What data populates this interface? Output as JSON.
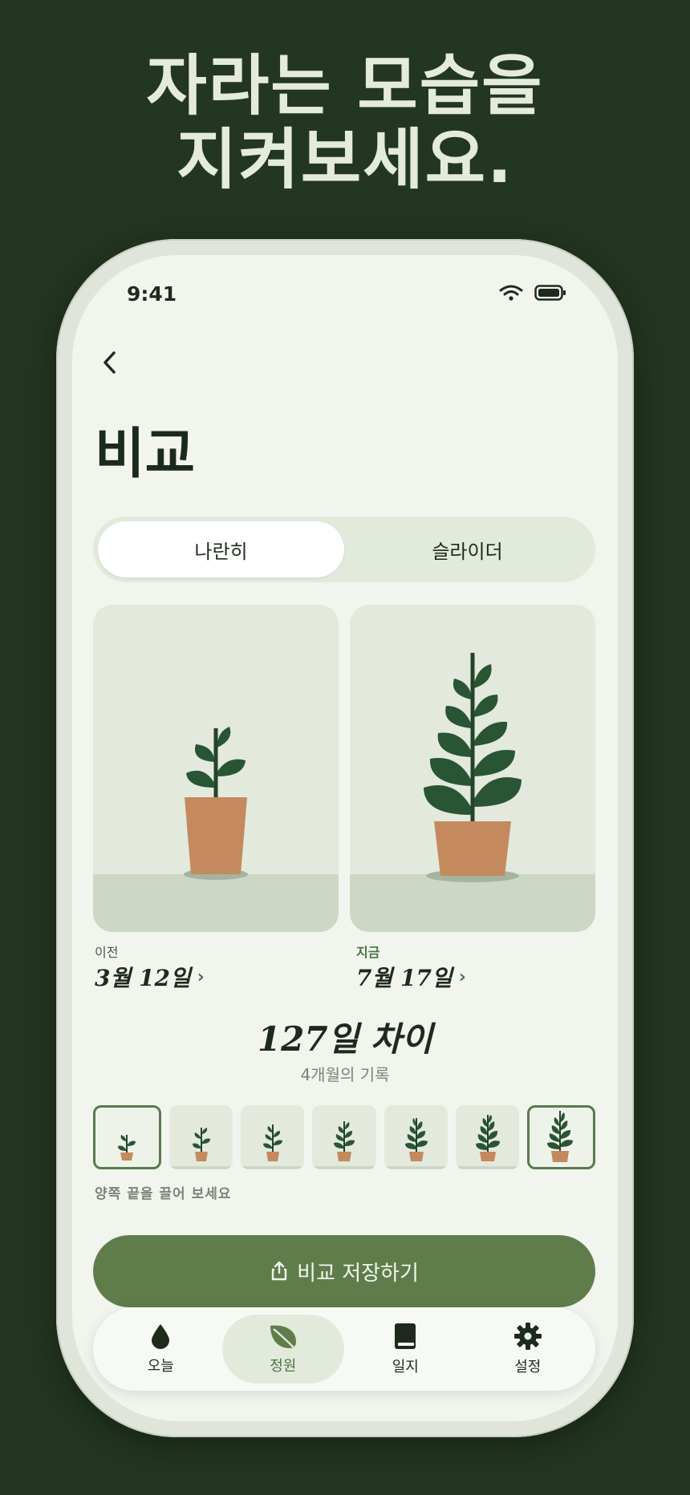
{
  "headline": {
    "line1": "자라는 모습을",
    "line2": "지켜보세요."
  },
  "status": {
    "time": "9:41"
  },
  "page": {
    "title": "비교"
  },
  "segment": {
    "options": [
      "나란히",
      "슬라이더"
    ],
    "selected": "나란히"
  },
  "before": {
    "label": "이전",
    "date": "3월 12일"
  },
  "after": {
    "label": "지금",
    "date": "7월 17일"
  },
  "difference": {
    "title": "127일 차이",
    "subtitle": "4개월의 기록"
  },
  "timeline": {
    "frame_count": 7,
    "selected_frames": [
      1,
      7
    ]
  },
  "hint": "양쪽 끝을 끌어 보세요",
  "cta": {
    "label": "비교 저장하기"
  },
  "tabs": [
    {
      "label": "오늘",
      "icon": "water-drop-icon"
    },
    {
      "label": "정원",
      "icon": "leaf-icon"
    },
    {
      "label": "일지",
      "icon": "book-icon"
    },
    {
      "label": "설정",
      "icon": "gear-icon"
    }
  ],
  "active_tab": "정원",
  "colors": {
    "background": "#233620",
    "accent": "#5e7d4b",
    "leaf": "#2a5535",
    "pot": "#c48a5e"
  }
}
